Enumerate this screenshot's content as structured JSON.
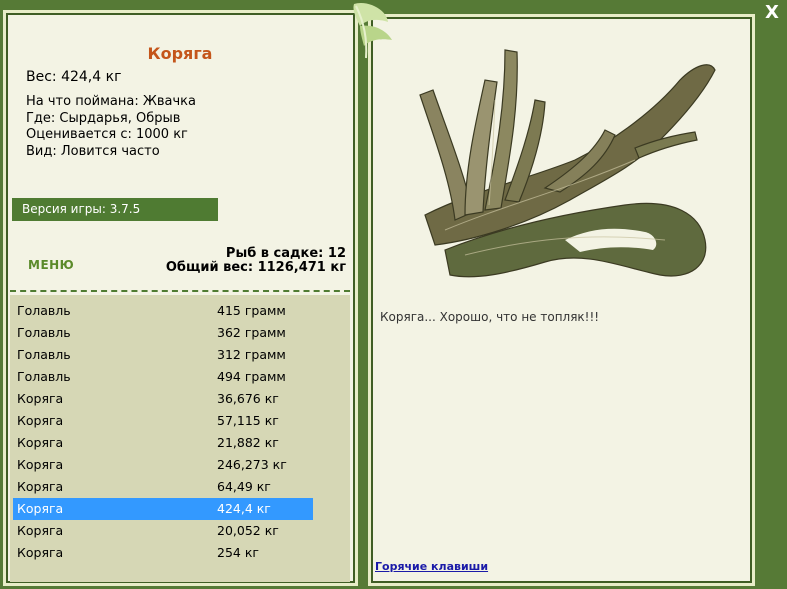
{
  "fish": {
    "title": "Коряга",
    "weight": "Вес: 424,4 кг",
    "caught_on": "На что поймана: Жвачка",
    "where": "Где: Сырдарья, Обрыв",
    "valued": "Оценивается с: 1000 кг",
    "kind": "Вид: Ловится часто",
    "comment": "Коряга... Хорошо, что не топляк!!!"
  },
  "version": "Версия игры: 3.7.5",
  "menu_label": "МЕНЮ",
  "stats": {
    "count": "Рыб в садке: 12",
    "total": "Общий вес: 1126,471 кг"
  },
  "catch_list": [
    {
      "name": "Голавль",
      "weight": "415 грамм"
    },
    {
      "name": "Голавль",
      "weight": "362 грамм"
    },
    {
      "name": "Голавль",
      "weight": "312 грамм"
    },
    {
      "name": "Голавль",
      "weight": "494 грамм"
    },
    {
      "name": "Коряга",
      "weight": "36,676 кг"
    },
    {
      "name": "Коряга",
      "weight": "57,115 кг"
    },
    {
      "name": "Коряга",
      "weight": "21,882 кг"
    },
    {
      "name": "Коряга",
      "weight": "246,273 кг"
    },
    {
      "name": "Коряга",
      "weight": "64,49 кг"
    },
    {
      "name": "Коряга",
      "weight": "424,4 кг"
    },
    {
      "name": "Коряга",
      "weight": "20,052 кг"
    },
    {
      "name": "Коряга",
      "weight": "254 кг"
    }
  ],
  "selected_index": 9,
  "hotkeys_label": "Горячие клавиши",
  "close_label": "X",
  "colors": {
    "background": "#567a36",
    "panel": "#f3f3e4",
    "list_bg": "#d6d7b5",
    "selected": "#3399ff",
    "title": "#c4551a"
  }
}
